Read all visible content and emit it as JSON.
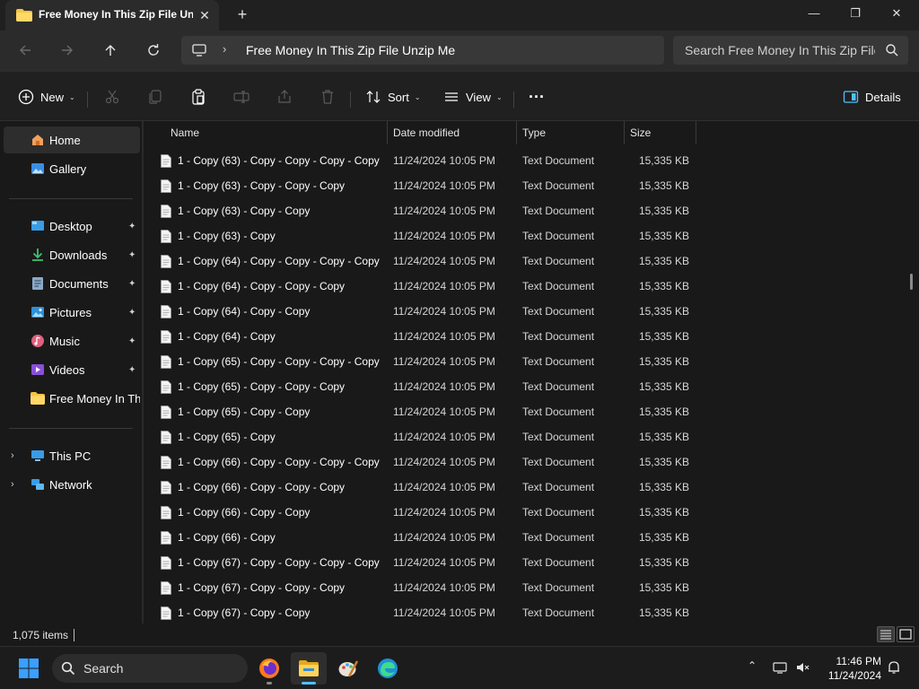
{
  "window": {
    "tab_title": "Free Money In This Zip File Un",
    "new_tab": "+",
    "close_tab": "✕",
    "minimize": "—",
    "restore": "❐",
    "close": "✕"
  },
  "address": {
    "separator": "›",
    "path": "Free Money In This Zip File Unzip Me"
  },
  "search": {
    "placeholder": "Search Free Money In This Zip File Unzip Me"
  },
  "commands": {
    "new_label": "New",
    "sort_label": "Sort",
    "view_label": "View",
    "more_label": "···",
    "details_label": "Details",
    "caret": "⌄"
  },
  "sidebar": {
    "items": [
      {
        "label": "Home",
        "icon": "home-icon"
      },
      {
        "label": "Gallery",
        "icon": "gallery-icon"
      },
      {
        "label": "Desktop",
        "icon": "desktop-icon",
        "pinned": true
      },
      {
        "label": "Downloads",
        "icon": "downloads-icon",
        "pinned": true
      },
      {
        "label": "Documents",
        "icon": "documents-icon",
        "pinned": true
      },
      {
        "label": "Pictures",
        "icon": "pictures-icon",
        "pinned": true
      },
      {
        "label": "Music",
        "icon": "music-icon",
        "pinned": true
      },
      {
        "label": "Videos",
        "icon": "videos-icon",
        "pinned": true
      },
      {
        "label": "Free Money In This",
        "icon": "folder-icon"
      },
      {
        "label": "This PC",
        "icon": "this-pc-icon"
      },
      {
        "label": "Network",
        "icon": "network-icon"
      }
    ],
    "pin_glyph": "📌",
    "chevron": "›"
  },
  "columns": {
    "name": "Name",
    "date": "Date modified",
    "type": "Type",
    "size": "Size",
    "sort_arrow": "^"
  },
  "files": [
    {
      "name": "1 - Copy (63) - Copy - Copy - Copy - Copy",
      "date": "11/24/2024 10:05 PM",
      "type": "Text Document",
      "size": "15,335 KB"
    },
    {
      "name": "1 - Copy (63) - Copy - Copy - Copy",
      "date": "11/24/2024 10:05 PM",
      "type": "Text Document",
      "size": "15,335 KB"
    },
    {
      "name": "1 - Copy (63) - Copy - Copy",
      "date": "11/24/2024 10:05 PM",
      "type": "Text Document",
      "size": "15,335 KB"
    },
    {
      "name": "1 - Copy (63) - Copy",
      "date": "11/24/2024 10:05 PM",
      "type": "Text Document",
      "size": "15,335 KB"
    },
    {
      "name": "1 - Copy (64) - Copy - Copy - Copy - Copy",
      "date": "11/24/2024 10:05 PM",
      "type": "Text Document",
      "size": "15,335 KB"
    },
    {
      "name": "1 - Copy (64) - Copy - Copy - Copy",
      "date": "11/24/2024 10:05 PM",
      "type": "Text Document",
      "size": "15,335 KB"
    },
    {
      "name": "1 - Copy (64) - Copy - Copy",
      "date": "11/24/2024 10:05 PM",
      "type": "Text Document",
      "size": "15,335 KB"
    },
    {
      "name": "1 - Copy (64) - Copy",
      "date": "11/24/2024 10:05 PM",
      "type": "Text Document",
      "size": "15,335 KB"
    },
    {
      "name": "1 - Copy (65) - Copy - Copy - Copy - Copy",
      "date": "11/24/2024 10:05 PM",
      "type": "Text Document",
      "size": "15,335 KB"
    },
    {
      "name": "1 - Copy (65) - Copy - Copy - Copy",
      "date": "11/24/2024 10:05 PM",
      "type": "Text Document",
      "size": "15,335 KB"
    },
    {
      "name": "1 - Copy (65) - Copy - Copy",
      "date": "11/24/2024 10:05 PM",
      "type": "Text Document",
      "size": "15,335 KB"
    },
    {
      "name": "1 - Copy (65) - Copy",
      "date": "11/24/2024 10:05 PM",
      "type": "Text Document",
      "size": "15,335 KB"
    },
    {
      "name": "1 - Copy (66) - Copy - Copy - Copy - Copy",
      "date": "11/24/2024 10:05 PM",
      "type": "Text Document",
      "size": "15,335 KB"
    },
    {
      "name": "1 - Copy (66) - Copy - Copy - Copy",
      "date": "11/24/2024 10:05 PM",
      "type": "Text Document",
      "size": "15,335 KB"
    },
    {
      "name": "1 - Copy (66) - Copy - Copy",
      "date": "11/24/2024 10:05 PM",
      "type": "Text Document",
      "size": "15,335 KB"
    },
    {
      "name": "1 - Copy (66) - Copy",
      "date": "11/24/2024 10:05 PM",
      "type": "Text Document",
      "size": "15,335 KB"
    },
    {
      "name": "1 - Copy (67) - Copy - Copy - Copy - Copy",
      "date": "11/24/2024 10:05 PM",
      "type": "Text Document",
      "size": "15,335 KB"
    },
    {
      "name": "1 - Copy (67) - Copy - Copy - Copy",
      "date": "11/24/2024 10:05 PM",
      "type": "Text Document",
      "size": "15,335 KB"
    },
    {
      "name": "1 - Copy (67) - Copy - Copy",
      "date": "11/24/2024 10:05 PM",
      "type": "Text Document",
      "size": "15,335 KB"
    }
  ],
  "status": {
    "item_count": "1,075 items"
  },
  "taskbar": {
    "search_placeholder": "Search",
    "apps": [
      "firefox-icon",
      "file-explorer-icon",
      "paint-icon",
      "edge-icon"
    ],
    "time": "11:46 PM",
    "date": "11/24/2024",
    "show_hidden": "⌃"
  },
  "colors": {
    "accent": "#4cc2ff",
    "background": "#191919",
    "folder": "#f4c542"
  }
}
